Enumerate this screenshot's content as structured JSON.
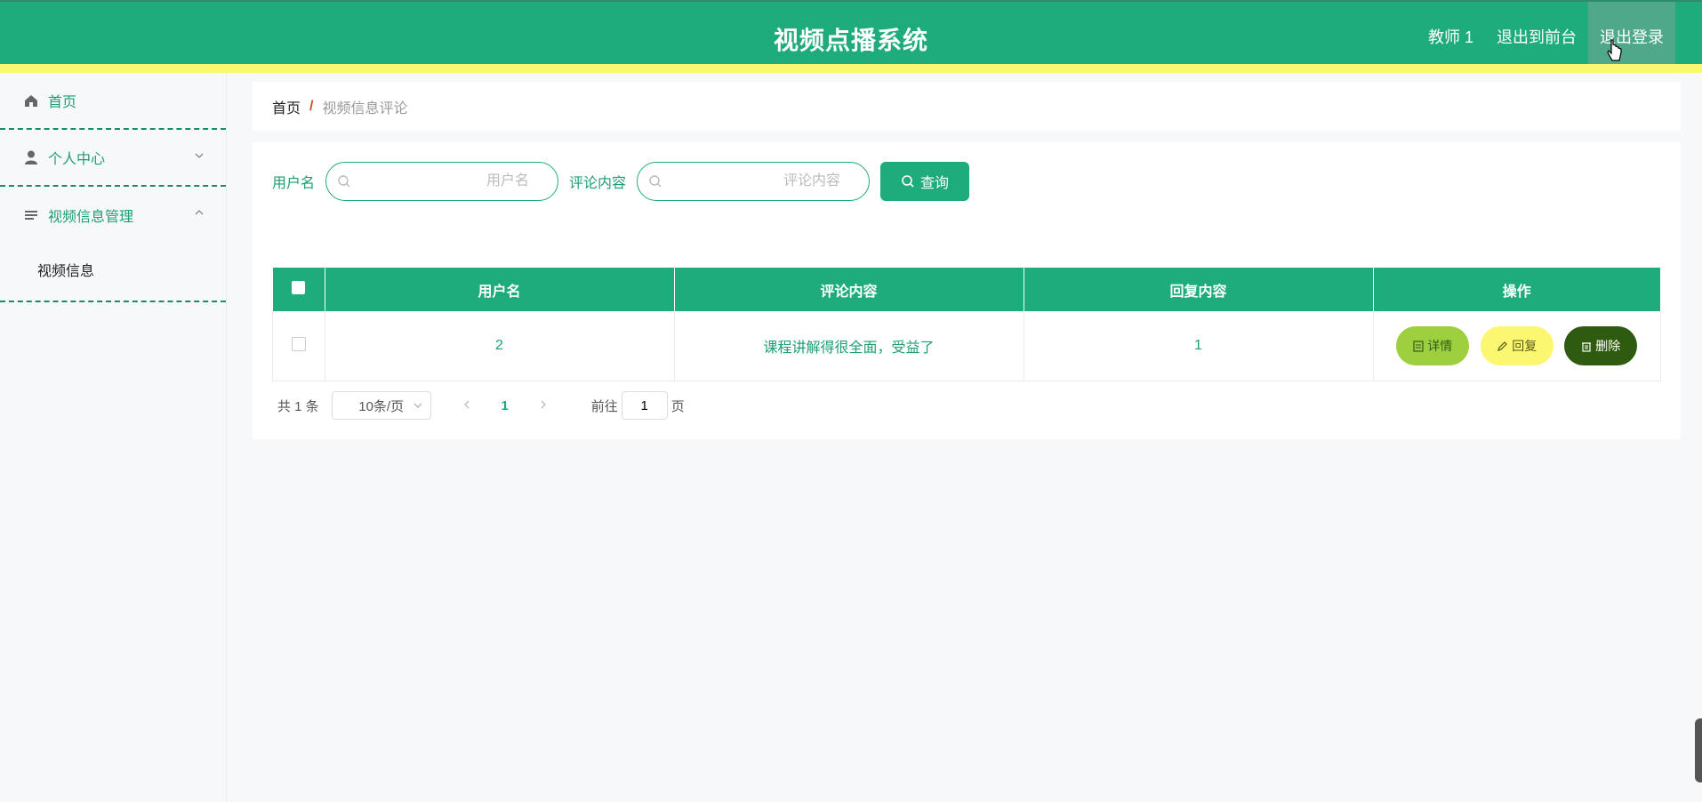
{
  "header": {
    "title": "视频点播系统",
    "nav": {
      "user": "教师 1",
      "back_to_front": "退出到前台",
      "logout": "退出登录"
    },
    "colors": {
      "primary": "#1fac7c",
      "strip": "#fbf770"
    }
  },
  "sidebar": {
    "home": "首页",
    "personal_center": "个人中心",
    "video_management": "视频信息管理",
    "video_info": "视频信息"
  },
  "breadcrumb": {
    "home": "首页",
    "separator": "/",
    "current": "视频信息评论"
  },
  "search": {
    "username_label": "用户名",
    "username_placeholder": "用户名",
    "comment_label": "评论内容",
    "comment_placeholder": "评论内容",
    "query_button": "查询"
  },
  "table": {
    "headers": {
      "username": "用户名",
      "comment": "评论内容",
      "reply": "回复内容",
      "actions": "操作"
    },
    "rows": [
      {
        "username": "2",
        "comment": "课程讲解得很全面，受益了",
        "reply": "1"
      }
    ],
    "actions": {
      "detail": "详情",
      "reply": "回复",
      "delete": "删除"
    }
  },
  "pagination": {
    "total": "共 1 条",
    "page_size": "10条/页",
    "current_page": "1",
    "goto_label": "前往",
    "goto_value": "1",
    "page_suffix": "页"
  }
}
